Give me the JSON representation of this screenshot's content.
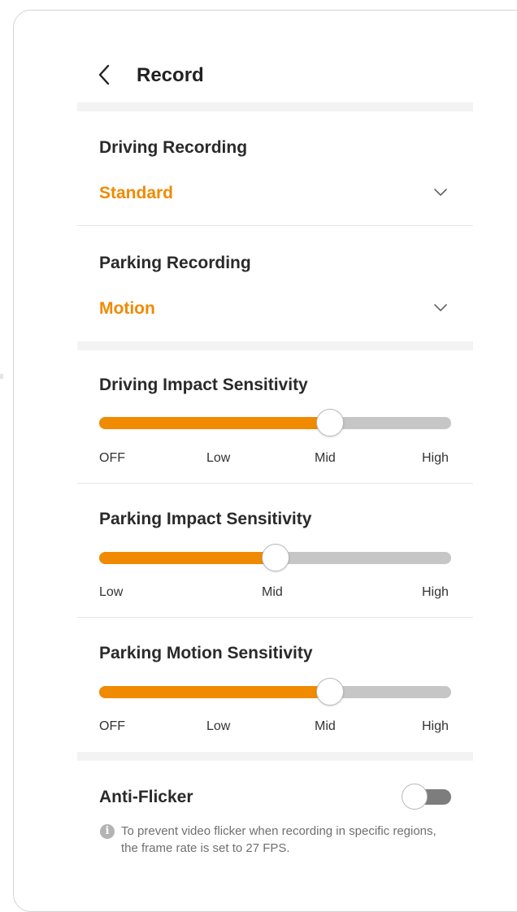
{
  "header": {
    "title": "Record"
  },
  "driving_recording": {
    "label": "Driving Recording",
    "value": "Standard"
  },
  "parking_recording": {
    "label": "Parking Recording",
    "value": "Motion"
  },
  "driving_impact": {
    "label": "Driving Impact Sensitivity",
    "ticks": [
      "OFF",
      "Low",
      "Mid",
      "High"
    ],
    "selected": "Mid",
    "fraction": 0.656
  },
  "parking_impact": {
    "label": "Parking Impact Sensitivity",
    "ticks": [
      "Low",
      "Mid",
      "High"
    ],
    "selected": "Mid",
    "fraction": 0.5
  },
  "parking_motion": {
    "label": "Parking Motion Sensitivity",
    "ticks": [
      "OFF",
      "Low",
      "Mid",
      "High"
    ],
    "selected": "Mid",
    "fraction": 0.656
  },
  "anti_flicker": {
    "label": "Anti-Flicker",
    "enabled": false,
    "info": "To prevent video flicker when recording in specific regions, the frame rate is set to 27 FPS."
  },
  "colors": {
    "accent": "#f08a00",
    "track": "#c6c6c6",
    "toggle_off": "#7d7d7d"
  }
}
